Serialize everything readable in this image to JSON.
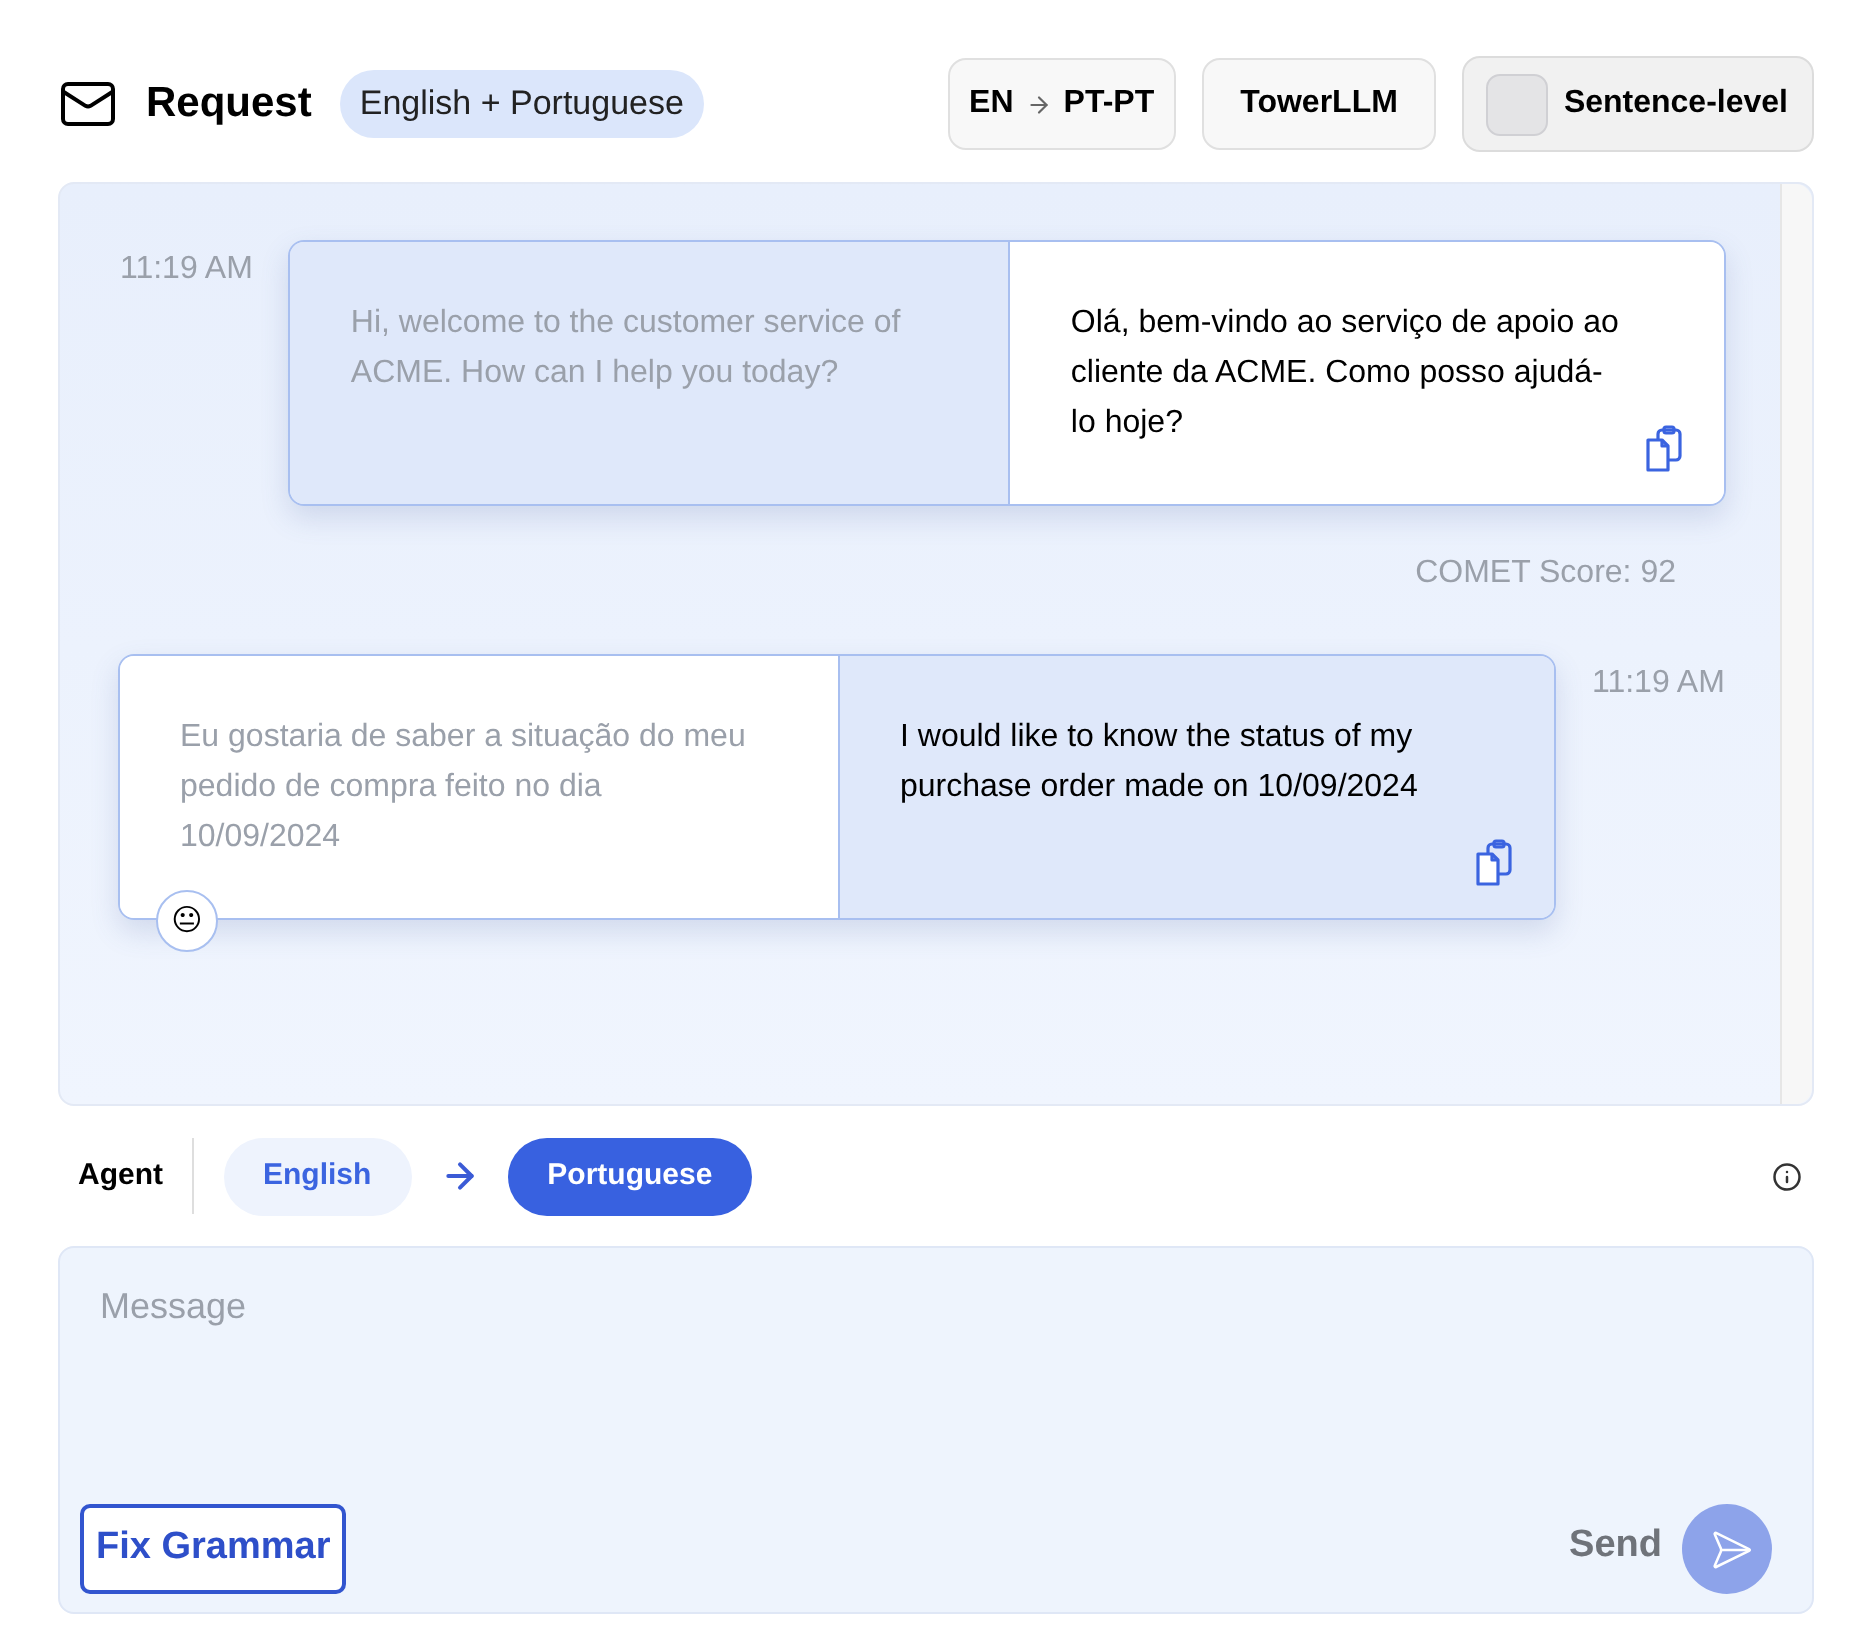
{
  "header": {
    "title": "Request",
    "language_badge": "English + Portuguese",
    "language_pair": {
      "source": "EN",
      "target": "PT-PT"
    },
    "model": "TowerLLM",
    "sentence_level": {
      "label": "Sentence-level",
      "checked": false
    }
  },
  "messages": [
    {
      "kind": "outgoing",
      "time": "11:19 AM",
      "original": "Hi, welcome to the customer service of ACME. How can I help you today?",
      "translation": "Olá, bem-vindo ao serviço de apoio ao cliente da ACME. Como posso ajudá-lo hoje?",
      "score": "COMET Score: 92"
    },
    {
      "kind": "incoming",
      "time": "11:19 AM",
      "original": "Eu gostaria de saber a situação do meu pedido de compra feito no dia 10/09/2024",
      "translation": "I would like to know the status of my purchase order made on 10/09/2024",
      "reaction": "😐"
    }
  ],
  "agent": {
    "label": "Agent",
    "languages": [
      {
        "label": "English",
        "selected": false
      },
      {
        "label": "Portuguese",
        "selected": true
      }
    ]
  },
  "composer": {
    "placeholder": "Message",
    "fix_button": "Fix Grammar",
    "send_label": "Send",
    "send_disabled": true
  }
}
